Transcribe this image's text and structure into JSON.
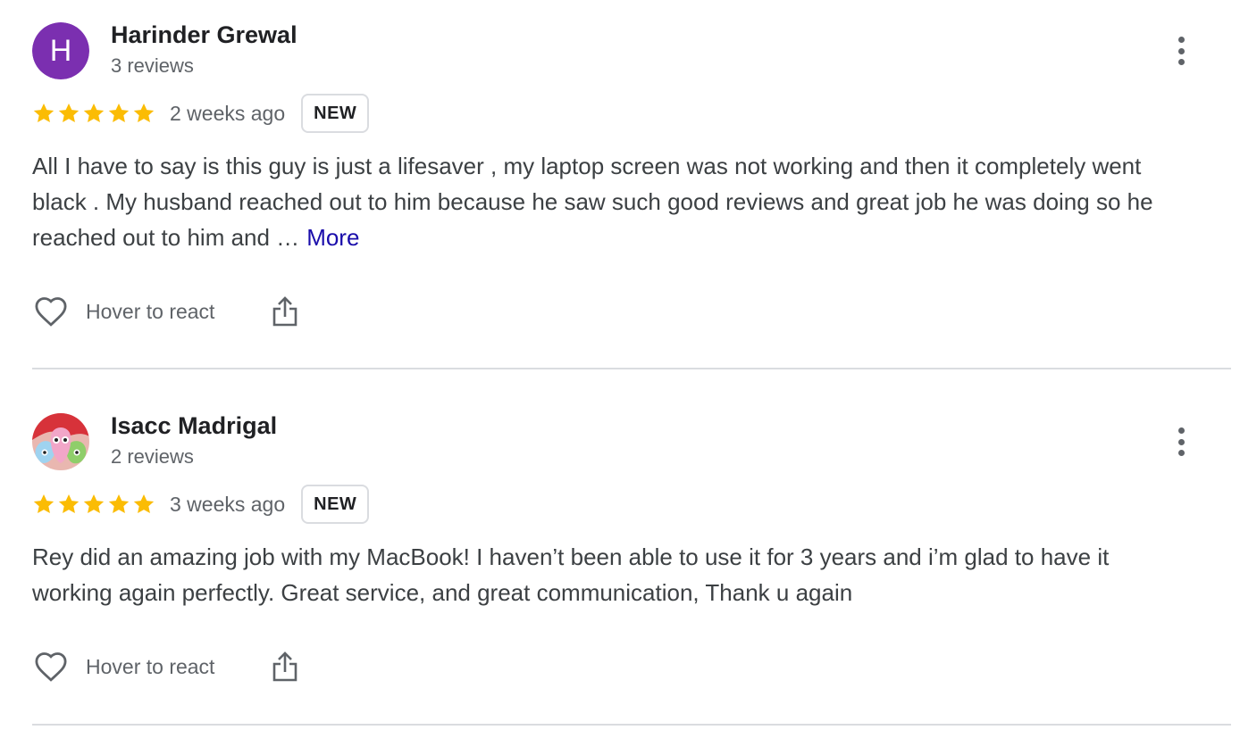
{
  "reviews": [
    {
      "avatar_letter": "H",
      "avatar_color": "#7b2fb0",
      "name": "Harinder Grewal",
      "review_count": "3 reviews",
      "rating": 5,
      "date": "2 weeks ago",
      "badge": "NEW",
      "text": "All I have to say is this guy is just a lifesaver , my laptop screen was not working and then it completely went black . My husband reached out to him because he saw such good reviews and great job he was doing so he reached out to him and …",
      "more_label": "More",
      "react_label": "Hover to react"
    },
    {
      "avatar_letter": "",
      "name": "Isacc Madrigal",
      "review_count": "2 reviews",
      "rating": 5,
      "date": "3 weeks ago",
      "badge": "NEW",
      "text": "Rey did an amazing job with my MacBook! I haven’t been able to use it for 3 years and i’m glad to have it working again perfectly. Great service, and great communication, Thank u again",
      "react_label": "Hover to react"
    }
  ],
  "icons": {
    "star": "star-icon",
    "heart": "heart-icon",
    "share": "share-icon",
    "menu": "more-vert-icon"
  },
  "colors": {
    "star": "#fbbc04",
    "link": "#1a0dab",
    "divider": "#dadce0"
  }
}
